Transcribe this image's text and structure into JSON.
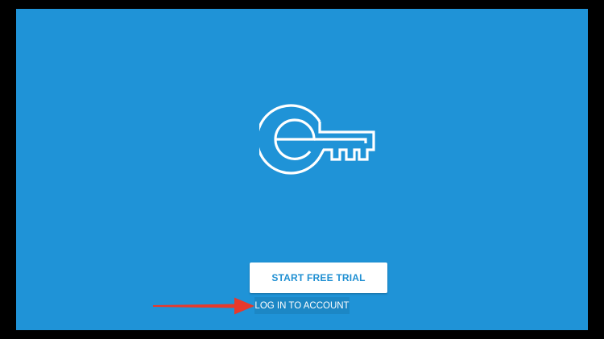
{
  "app": {
    "logo_icon": "key-icon",
    "background_color": "#1f93d7",
    "accent_color": "#1f8fd2"
  },
  "buttons": {
    "start_trial_label": "START FREE TRIAL",
    "login_label": "LOG IN TO ACCOUNT"
  },
  "annotation": {
    "arrow_icon": "red-arrow-icon",
    "arrow_color": "#e8392b"
  }
}
